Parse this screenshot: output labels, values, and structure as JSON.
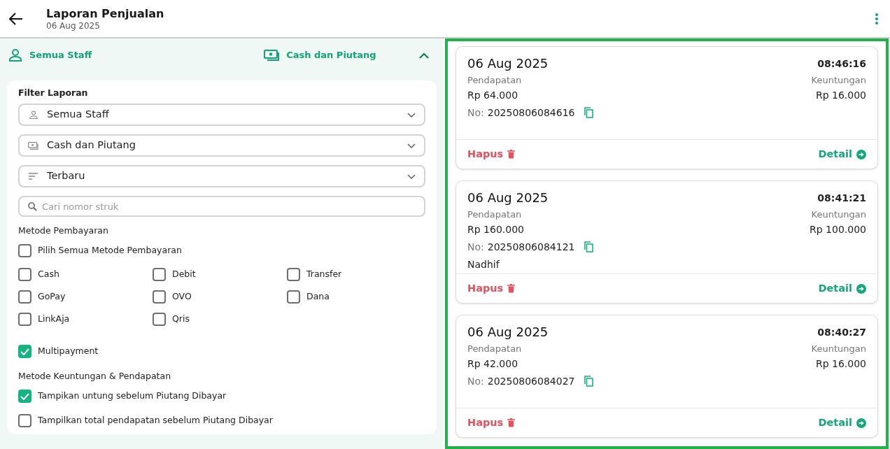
{
  "header": {
    "title": "Laporan Penjualan",
    "subtitle": "06 Aug 2025"
  },
  "summary_bar": {
    "staff": "Semua Staff",
    "payment": "Cash dan Piutang",
    "expanded": true
  },
  "filter": {
    "title": "Filter Laporan",
    "dropdowns": [
      {
        "kind": "staff",
        "value": "Semua Staff"
      },
      {
        "kind": "payment",
        "value": "Cash dan Piutang"
      },
      {
        "kind": "sort",
        "value": "Terbaru"
      }
    ],
    "search": {
      "placeholder": "Cari nomor struk"
    },
    "payment_title": "Metode Pembayaran",
    "select_all": {
      "label": "Pilih Semua Metode Pembayaran",
      "checked": false
    },
    "methods": [
      {
        "label": "Cash",
        "checked": false
      },
      {
        "label": "Debit",
        "checked": false
      },
      {
        "label": "Transfer",
        "checked": false
      },
      {
        "label": "GoPay",
        "checked": false
      },
      {
        "label": "OVO",
        "checked": false
      },
      {
        "label": "Dana",
        "checked": false
      },
      {
        "label": "LinkAja",
        "checked": false
      },
      {
        "label": "Qris",
        "checked": false
      }
    ],
    "multipayment": {
      "label": "Multipayment",
      "checked": true
    },
    "profit_title": "Metode Keuntungan & Pendapatan",
    "profit_options": [
      {
        "label": "Tampikan untung sebelum Piutang Dibayar",
        "checked": true
      },
      {
        "label": "Tampilkan total pendapatan sebelum Piutang Dibayar",
        "checked": false
      }
    ]
  },
  "transactions": [
    {
      "date": "06 Aug 2025",
      "time": "08:46:16",
      "revenue_label": "Pendapatan",
      "revenue": "Rp 64.000",
      "profit_label": "Keuntungan",
      "profit": "Rp 16.000",
      "no_label": "No:",
      "number": "20250806084616",
      "delete": "Hapus",
      "detail": "Detail"
    },
    {
      "date": "06 Aug 2025",
      "time": "08:41:21",
      "revenue_label": "Pendapatan",
      "revenue": "Rp 160.000",
      "profit_label": "Keuntungan",
      "profit": "Rp 100.000",
      "no_label": "No:",
      "number": "20250806084121",
      "staff": "Nadhif",
      "delete": "Hapus",
      "detail": "Detail"
    },
    {
      "date": "06 Aug 2025",
      "time": "08:40:27",
      "revenue_label": "Pendapatan",
      "revenue": "Rp 42.000",
      "profit_label": "Keuntungan",
      "profit": "Rp 16.000",
      "no_label": "No:",
      "number": "20250806084027",
      "delete": "Hapus",
      "detail": "Detail"
    }
  ]
}
